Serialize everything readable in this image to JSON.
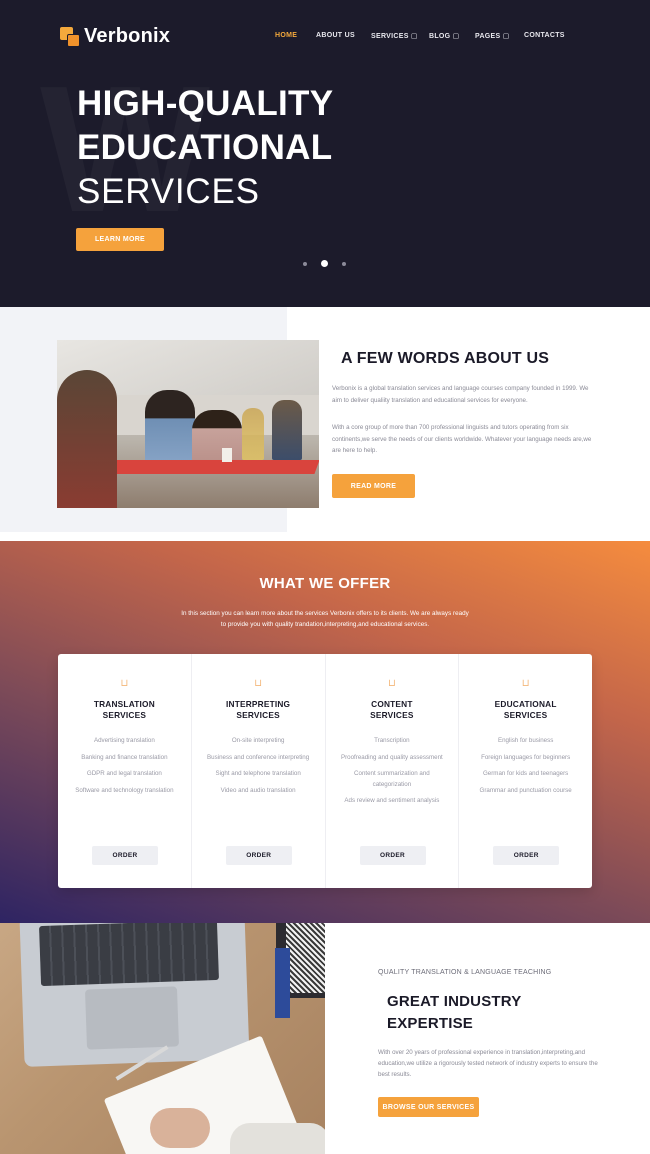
{
  "brand": {
    "name": "Verbonix"
  },
  "nav": {
    "items": [
      {
        "label": "HOME",
        "active": true
      },
      {
        "label": "ABOUT US"
      },
      {
        "label": "SERVICES ▢"
      },
      {
        "label": "BLOG ▢"
      },
      {
        "label": "PAGES ▢"
      },
      {
        "label": "CONTACTS"
      }
    ]
  },
  "hero": {
    "line1": "HIGH-QUALITY",
    "line2": "EDUCATIONAL",
    "line3": "SERVICES",
    "button": "LEARN MORE",
    "slides": 3,
    "active_slide": 2
  },
  "about": {
    "title": "A FEW WORDS ABOUT US",
    "p1": "Verbonix is a global translation services and language courses company founded in 1999. We aim to deliver qualiity translation and educational services for everyone.",
    "p2": "With a core group of more than 700 professional linguists and tutors operating from six continents,we serve the needs of our clients worldwide. Whatever your language needs are,we are here to help.",
    "button": "READ MORE"
  },
  "offer": {
    "title": "WHAT WE OFFER",
    "line1": "In this section you can learn more about the services Verbonix offers to its clients. We are always ready",
    "line2": "to provide you with quality trandation,interpreting,and educational services.",
    "cards": [
      {
        "title1": "TRANSLATION",
        "title2": "SERVICES",
        "items": [
          "Advertising translation",
          "Banking and finance translation",
          "GDPR and legal translation",
          "Software and technology translation"
        ],
        "button": "ORDER"
      },
      {
        "title1": "INTERPRETING",
        "title2": "SERVICES",
        "items": [
          "On-site interpreting",
          "Business and conference interpreting",
          "Sight and telephone translation",
          "Video and audio translation"
        ],
        "button": "ORDER"
      },
      {
        "title1": "CONTENT",
        "title2": "SERVICES",
        "items": [
          "Transcription",
          "Proofreading and quality assessment",
          "Content summarization and categorization",
          "Ads review and sentiment analysis"
        ],
        "button": "ORDER"
      },
      {
        "title1": "EDUCATIONAL",
        "title2": "SERVICES",
        "items": [
          "English for business",
          "Foreign languages for beginners",
          "German for kids and teenagers",
          "Grammar and punctuation course"
        ],
        "button": "ORDER"
      }
    ],
    "icon": "⊔"
  },
  "expertise": {
    "subtitle": "QUALITY TRANSLATION & LANGUAGE TEACHING",
    "title1": "GREAT INDUSTRY",
    "title2": "EXPERTISE",
    "text": "With over 20 years of professional experience in translation,interpreting,and education,we utilize a rigorously tested network of industry experts to ensure the best results.",
    "button": "BROWSE OUR SERVICES"
  },
  "colors": {
    "accent": "#f5a23c",
    "dark": "#1c1b2b"
  }
}
